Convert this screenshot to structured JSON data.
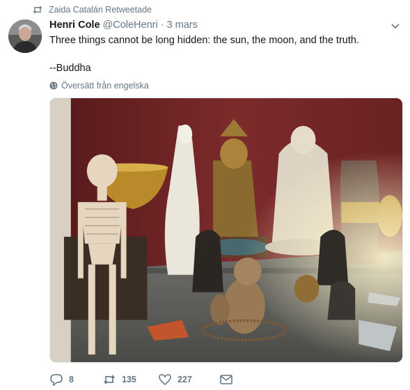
{
  "retweet_banner": {
    "text": "Zaida Catalán Retweetade",
    "icon": "retweet-icon"
  },
  "author": {
    "name": "Henri Cole",
    "handle": "@ColeHenri",
    "separator": "·",
    "date": "3 mars"
  },
  "tweet": {
    "line1": "Three things cannot be long hidden: the sun, the moon, and the truth.",
    "line2": "--Buddha"
  },
  "translate": {
    "label": "Översätt från engelska",
    "icon": "globe-icon"
  },
  "actions": {
    "reply_count": "8",
    "retweet_count": "135",
    "like_count": "227"
  },
  "colors": {
    "muted": "#657786",
    "text": "#14171a",
    "wall": "#7a2a2a"
  }
}
